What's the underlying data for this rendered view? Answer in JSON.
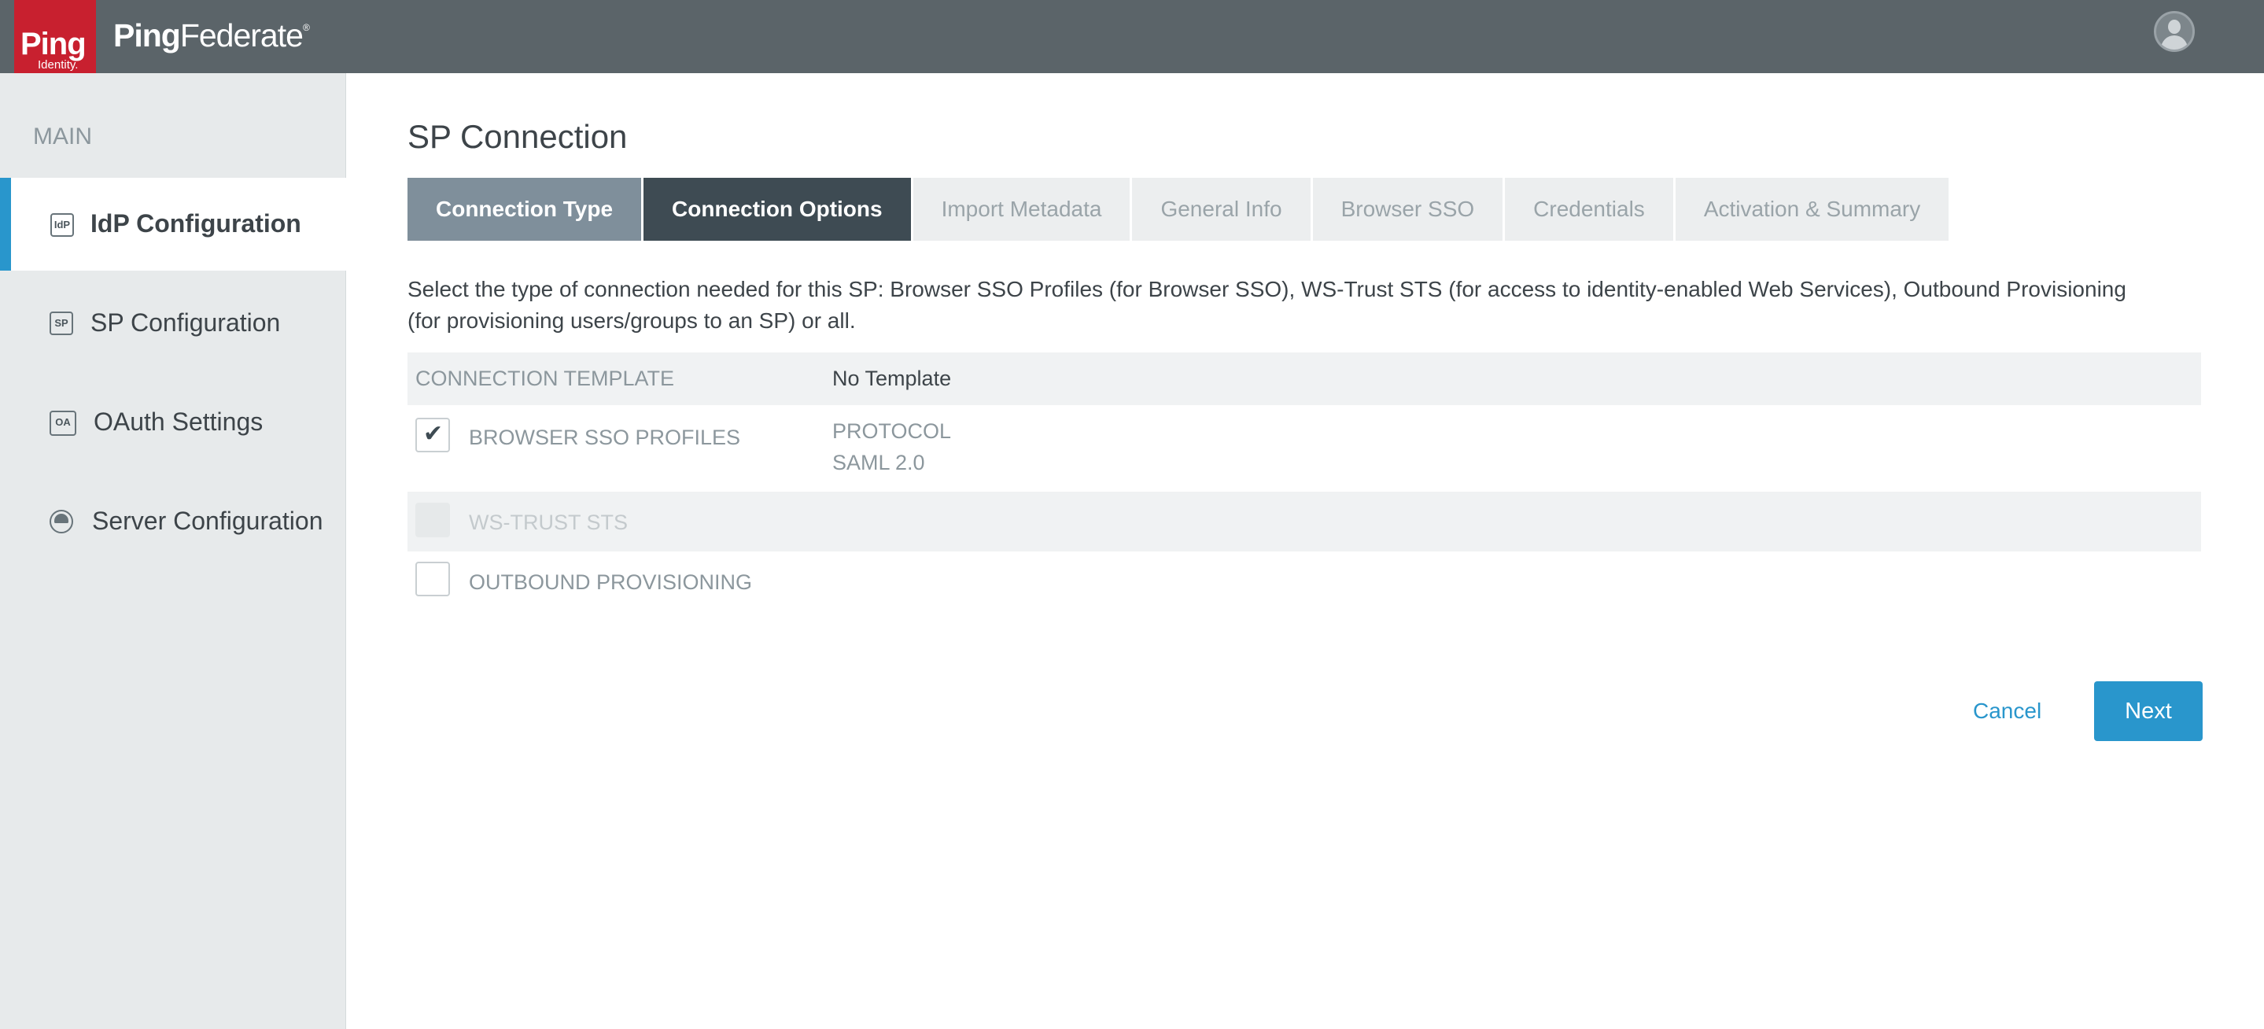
{
  "header": {
    "logo_text": "Ping",
    "logo_subtext": "Identity.",
    "brand_bold": "Ping",
    "brand_rest": "Federate",
    "brand_mark": "®",
    "user_icon": "user-avatar-icon"
  },
  "sidebar": {
    "heading": "MAIN",
    "items": [
      {
        "label": "IdP Configuration",
        "icon_text": "IdP",
        "icon": "idp-icon",
        "active": true
      },
      {
        "label": "SP Configuration",
        "icon_text": "SP",
        "icon": "sp-icon",
        "active": false
      },
      {
        "label": "OAuth Settings",
        "icon_text": "OA",
        "icon": "oauth-icon",
        "active": false
      },
      {
        "label": "Server Configuration",
        "icon_text": "",
        "icon": "server-icon",
        "active": false
      }
    ]
  },
  "main": {
    "title": "SP Connection",
    "tabs": [
      {
        "label": "Connection Type",
        "state": "done"
      },
      {
        "label": "Connection Options",
        "state": "current"
      },
      {
        "label": "Import Metadata",
        "state": "pending"
      },
      {
        "label": "General Info",
        "state": "pending"
      },
      {
        "label": "Browser SSO",
        "state": "pending"
      },
      {
        "label": "Credentials",
        "state": "pending"
      },
      {
        "label": "Activation & Summary",
        "state": "pending"
      }
    ],
    "description": "Select the type of connection needed for this SP: Browser SSO Profiles (for Browser SSO), WS-Trust STS (for access to identity-enabled Web Services), Outbound Provisioning (for provisioning users/groups to an SP) or all.",
    "template_label": "CONNECTION TEMPLATE",
    "template_value": "No Template",
    "options": {
      "browser_sso": {
        "label": "BROWSER SSO PROFILES",
        "checked": true,
        "protocol_label": "PROTOCOL",
        "protocol_value": "SAML 2.0"
      },
      "ws_trust": {
        "label": "WS-TRUST STS",
        "checked": false,
        "disabled": true
      },
      "outbound": {
        "label": "OUTBOUND PROVISIONING",
        "checked": false
      }
    },
    "cancel_label": "Cancel",
    "next_label": "Next"
  },
  "colors": {
    "topbar": "#5b6469",
    "brand_red": "#c8202f",
    "accent_blue": "#2996cc",
    "tab_done": "#7f8f9b",
    "tab_current": "#3e4b53"
  }
}
